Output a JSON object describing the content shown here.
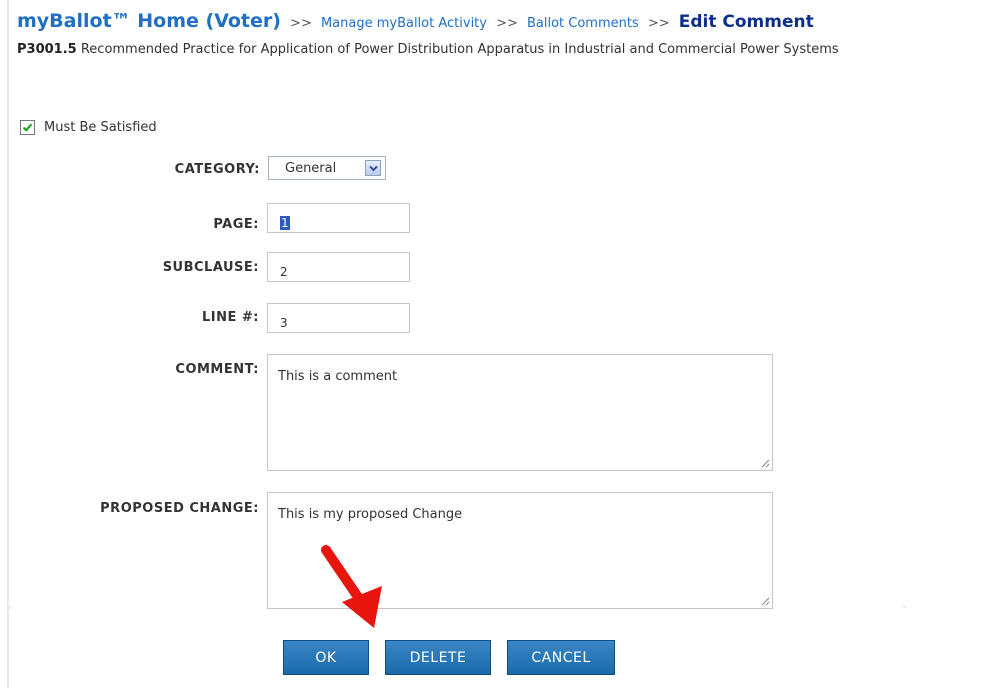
{
  "breadcrumb": {
    "home": "myBallot™ Home (Voter)",
    "separator": ">>",
    "manage": "Manage myBallot Activity",
    "comments": "Ballot Comments",
    "current": "Edit Comment"
  },
  "project": {
    "id": "P3001.5",
    "title": "Recommended Practice for Application of Power Distribution Apparatus in Industrial and Commercial Power Systems"
  },
  "must_be_satisfied": {
    "label": "Must Be Satisfied",
    "checked": true
  },
  "form": {
    "category": {
      "label": "CATEGORY:",
      "value": "General"
    },
    "page": {
      "label": "PAGE:",
      "value": "1"
    },
    "subclause": {
      "label": "SUBCLAUSE:",
      "value": "2"
    },
    "line": {
      "label": "LINE #:",
      "value": "3"
    },
    "comment": {
      "label": "COMMENT:",
      "value": "This is a comment"
    },
    "proposed_change": {
      "label": "PROPOSED CHANGE:",
      "value": "This is my proposed Change"
    }
  },
  "buttons": {
    "ok": "OK",
    "delete": "DELETE",
    "cancel": "CANCEL"
  },
  "colors": {
    "link": "#1f6fc5",
    "button": "#2a78ba",
    "annotation_arrow": "#e8140e"
  },
  "icons": {
    "checkbox": "checkmark-icon",
    "dropdown": "chevron-down-icon",
    "resize": "resize-grip-icon",
    "annotation": "red-arrow-icon"
  }
}
